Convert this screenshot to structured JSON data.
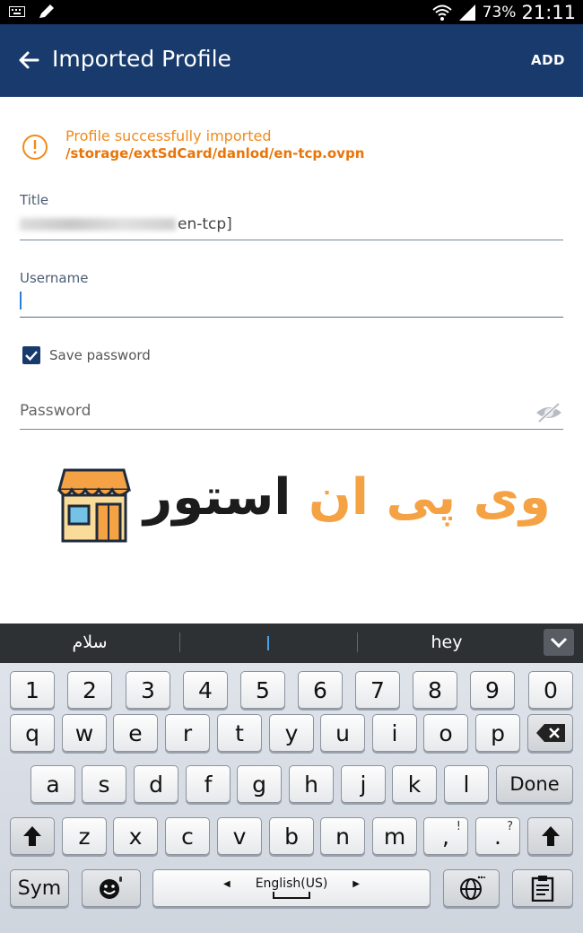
{
  "status_bar": {
    "battery": "73%",
    "time": "21:11",
    "icons": [
      "keyboard-icon",
      "pencil-icon",
      "wifi-icon",
      "signal-icon"
    ]
  },
  "app_bar": {
    "title": "Imported Profile",
    "action": "ADD",
    "background": "#183a6c"
  },
  "notice": {
    "message": "Profile successfully imported",
    "path": "/storage/extSdCard/danlod/en-tcp.ovpn",
    "color": "#f08a1c"
  },
  "form": {
    "title_label": "Title",
    "title_value": "en-tcp]",
    "username_label": "Username",
    "username_value": "",
    "save_password_label": "Save password",
    "save_password_checked": true,
    "password_label": "Password"
  },
  "watermark": {
    "text_dark": "استور",
    "text_orange": "وی پی ان"
  },
  "keyboard": {
    "suggestions": [
      "سلام",
      "",
      "hey"
    ],
    "row1": [
      "1",
      "2",
      "3",
      "4",
      "5",
      "6",
      "7",
      "8",
      "9",
      "0"
    ],
    "row2": [
      "q",
      "w",
      "e",
      "r",
      "t",
      "y",
      "u",
      "i",
      "o",
      "p"
    ],
    "row3": [
      "a",
      "s",
      "d",
      "f",
      "g",
      "h",
      "j",
      "k",
      "l"
    ],
    "done_label": "Done",
    "row4": [
      "z",
      "x",
      "c",
      "v",
      "b",
      "n",
      "m",
      ",",
      "."
    ],
    "row4_subs": [
      "",
      "",
      "",
      "",
      "",
      "",
      "",
      "!",
      "?"
    ],
    "sym_label": "Sym",
    "space_label": "English(US)"
  }
}
